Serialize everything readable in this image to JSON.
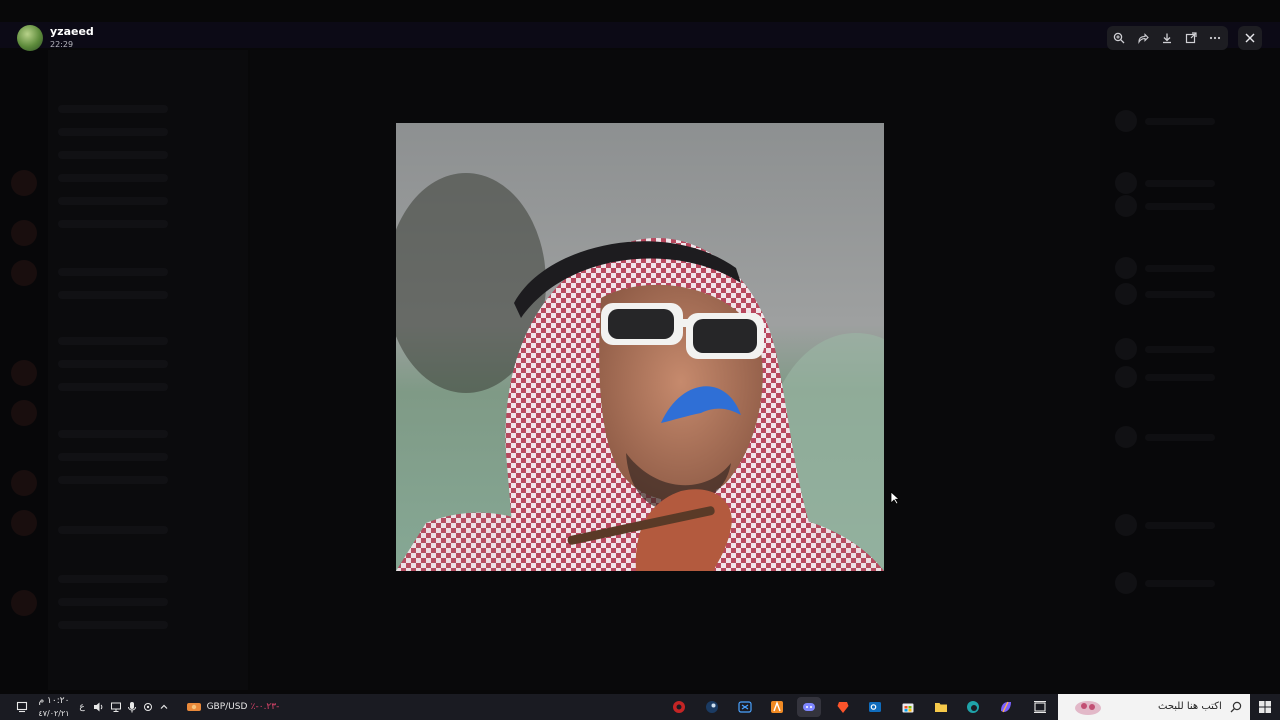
{
  "viewer": {
    "user_name": "yzaeed",
    "timestamp": "22:29",
    "toolbar": {
      "zoom_icon": "zoom-in-icon",
      "forward_icon": "forward-icon",
      "download_icon": "download-icon",
      "open_external_icon": "open-external-icon",
      "more_icon": "more-icon",
      "close_icon": "close-icon"
    }
  },
  "taskbar": {
    "time": "١٠:٢٠ م",
    "date": "٤٧/٠٢/٢١",
    "language": "ع",
    "ticker_label": "GBP/USD",
    "ticker_change": "٪-٠.٢٣-",
    "search_placeholder": "اكتب هنا للبحث",
    "colors": {
      "ticker_change": "#e0466d",
      "taskbar_bg": "#1a1b22"
    }
  }
}
